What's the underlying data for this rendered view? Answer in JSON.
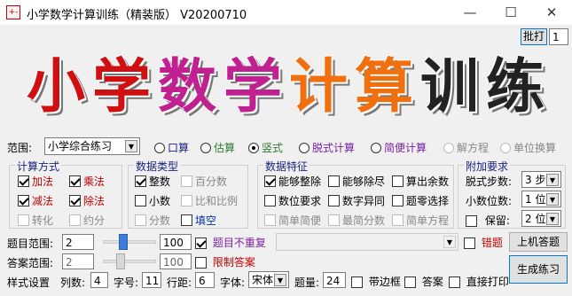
{
  "window": {
    "title": "小学数学计算训练（精装版） V20200710",
    "min": "—",
    "max": "☐",
    "close": "✕"
  },
  "top_right": {
    "batch_label": "批打",
    "batch_value": "1"
  },
  "banner": {
    "chars": [
      "小",
      "学",
      "数",
      "学",
      "计",
      "算",
      "训",
      "练"
    ],
    "colors": [
      "#d01010",
      "#d01010",
      "#c02090",
      "#c02090",
      "#f07010",
      "#f07010",
      "#222222",
      "#222222"
    ]
  },
  "range": {
    "label": "范围:",
    "value": "小学综合练习"
  },
  "modes": [
    {
      "label": "口算",
      "selected": false,
      "enabled": true,
      "color": "#1a237e"
    },
    {
      "label": "估算",
      "selected": false,
      "enabled": true,
      "color": "#2e7d32"
    },
    {
      "label": "竖式",
      "selected": true,
      "enabled": true,
      "color": "#2e7d32"
    },
    {
      "label": "脱式计算",
      "selected": false,
      "enabled": true,
      "color": "#7a1fa2"
    },
    {
      "label": "简便计算",
      "selected": false,
      "enabled": true,
      "color": "#7a1fa2"
    },
    {
      "label": "解方程",
      "selected": false,
      "enabled": false,
      "color": "#888888"
    },
    {
      "label": "单位换算",
      "selected": false,
      "enabled": false,
      "color": "#888888"
    }
  ],
  "calc_method": {
    "title": "计算方式",
    "items": [
      {
        "label": "加法",
        "checked": true,
        "color": "#c00000"
      },
      {
        "label": "乘法",
        "checked": true,
        "color": "#c00000"
      },
      {
        "label": "减法",
        "checked": true,
        "color": "#c00000"
      },
      {
        "label": "除法",
        "checked": true,
        "color": "#c00000"
      },
      {
        "label": "转化",
        "checked": false,
        "color": "#888888"
      },
      {
        "label": "约分",
        "checked": false,
        "color": "#888888"
      }
    ]
  },
  "data_type": {
    "title": "数据类型",
    "items": [
      {
        "label": "整数",
        "checked": true,
        "color": "#000000"
      },
      {
        "label": "百分数",
        "checked": false,
        "color": "#888888"
      },
      {
        "label": "小数",
        "checked": false,
        "color": "#000000"
      },
      {
        "label": "比和比例",
        "checked": false,
        "color": "#888888"
      },
      {
        "label": "分数",
        "checked": false,
        "color": "#888888"
      },
      {
        "label": "填空",
        "checked": false,
        "color": "#0033aa"
      }
    ]
  },
  "data_feature": {
    "title": "数据特征",
    "items": [
      {
        "label": "能够整除",
        "checked": true,
        "color": "#000000"
      },
      {
        "label": "能够除尽",
        "checked": false,
        "color": "#000000"
      },
      {
        "label": "算出余数",
        "checked": false,
        "color": "#000000"
      },
      {
        "label": "数位要求",
        "checked": false,
        "color": "#000000"
      },
      {
        "label": "数字异同",
        "checked": false,
        "color": "#000000"
      },
      {
        "label": "题零选择",
        "checked": false,
        "color": "#000000"
      },
      {
        "label": "简单简便",
        "checked": false,
        "color": "#888888"
      },
      {
        "label": "最简分数",
        "checked": false,
        "color": "#888888"
      },
      {
        "label": "简单方程",
        "checked": false,
        "color": "#888888"
      }
    ]
  },
  "extra": {
    "title": "附加要求",
    "steps_label": "脱式步数:",
    "steps_value": "3 步",
    "decimals_label": "小数位数:",
    "decimals_value": "1 位",
    "keep_label": "保留:",
    "keep_value": "2 位"
  },
  "question_range": {
    "label": "题目范围:",
    "min": "2",
    "max": "100",
    "slider_value": 0.35
  },
  "answer_range": {
    "label": "答案范围:",
    "min": "2",
    "max": "100",
    "slider_value": 0.3
  },
  "no_repeat": {
    "label": "题目不重复",
    "checked": true
  },
  "limit_answer": {
    "label": "限制答案",
    "checked": false
  },
  "mistake": {
    "label": "错题",
    "checked": false
  },
  "online_button": "上机答题",
  "generate_button": "生成练习",
  "style": {
    "label": "样式设置",
    "columns_label": "列数:",
    "columns_value": "4",
    "fontsize_label": "字号:",
    "fontsize_value": "11",
    "linespace_label": "行距:",
    "linespace_value": "6",
    "font_label": "字体:",
    "font_value": "宋体",
    "count_label": "题量:",
    "count_value": "24",
    "border_label": "带边框",
    "border_checked": false,
    "answer_label": "答案",
    "answer_checked": false,
    "print_label": "直接打印",
    "print_checked": false
  }
}
